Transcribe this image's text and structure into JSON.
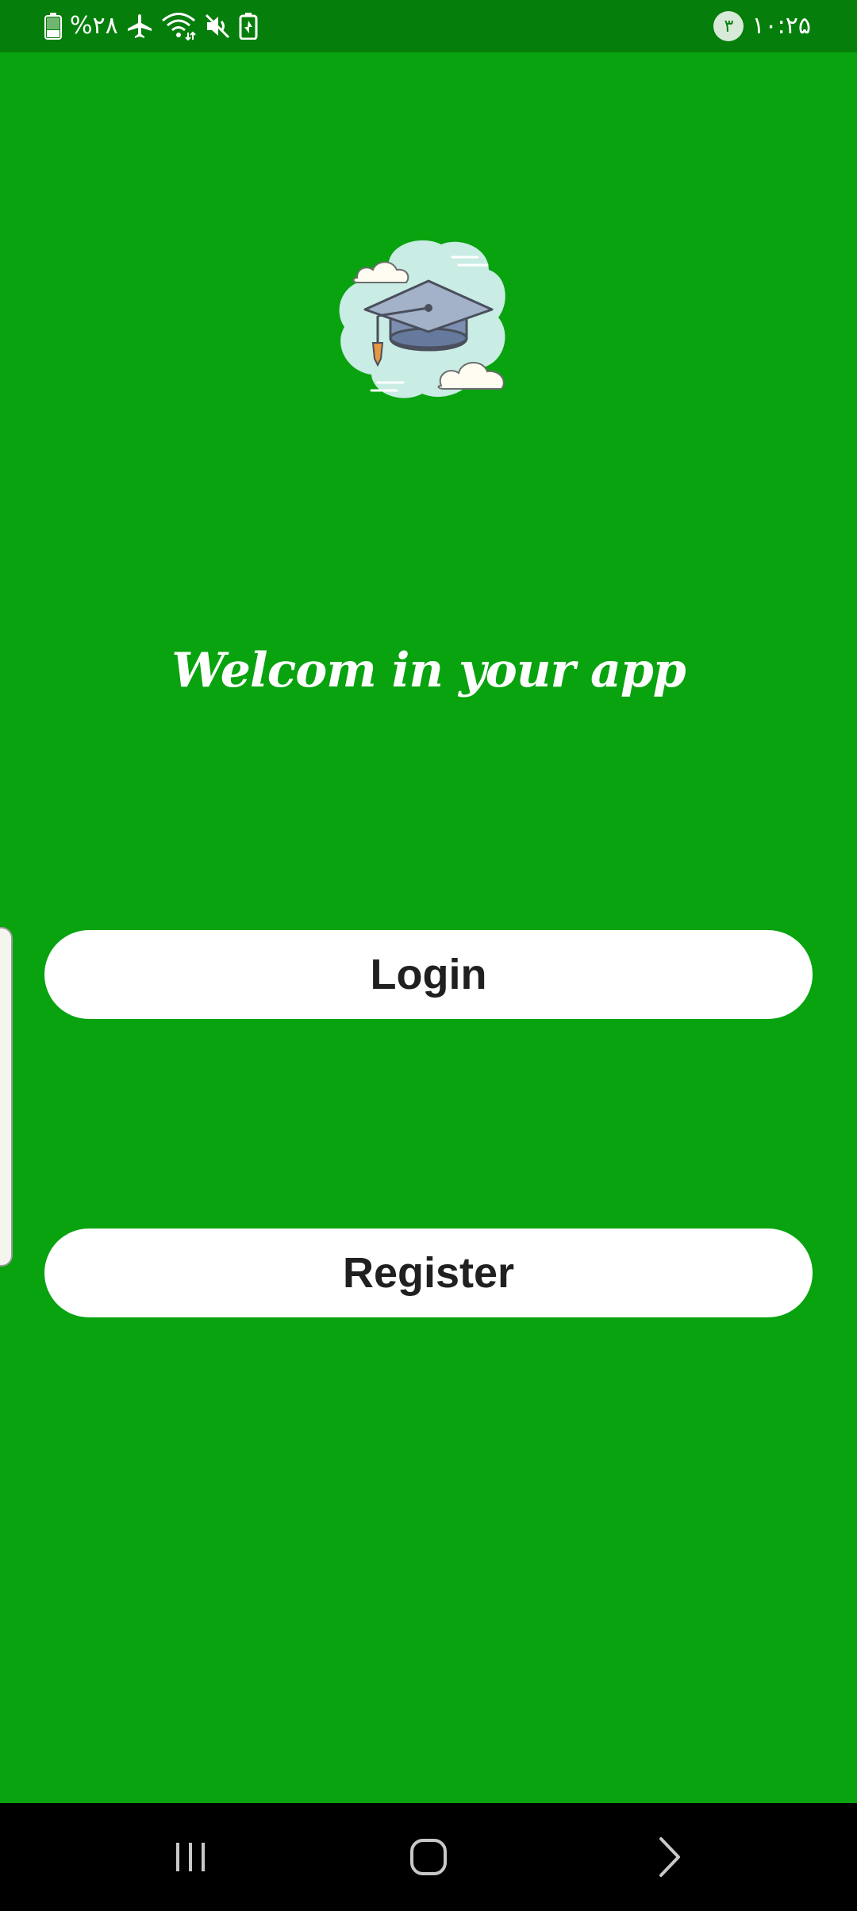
{
  "status_bar": {
    "battery_percent": "%۲۸",
    "time": "۱۰:۲۵",
    "notification_count": "۳",
    "icons": [
      "battery-icon",
      "airplane-mode-icon",
      "wifi-icon",
      "mute-icon",
      "battery-saver-icon"
    ]
  },
  "app": {
    "logo_icon": "graduation-cap-icon",
    "welcome_text": "Welcom in your app",
    "login_label": "Login",
    "register_label": "Register"
  },
  "nav_bar": {
    "icons": [
      "recents-icon",
      "home-icon",
      "back-icon"
    ]
  },
  "colors": {
    "background": "#08a30f",
    "status_bar": "#067e0b",
    "button": "#ffffff",
    "button_text": "#202020",
    "nav_bar": "#000000"
  }
}
